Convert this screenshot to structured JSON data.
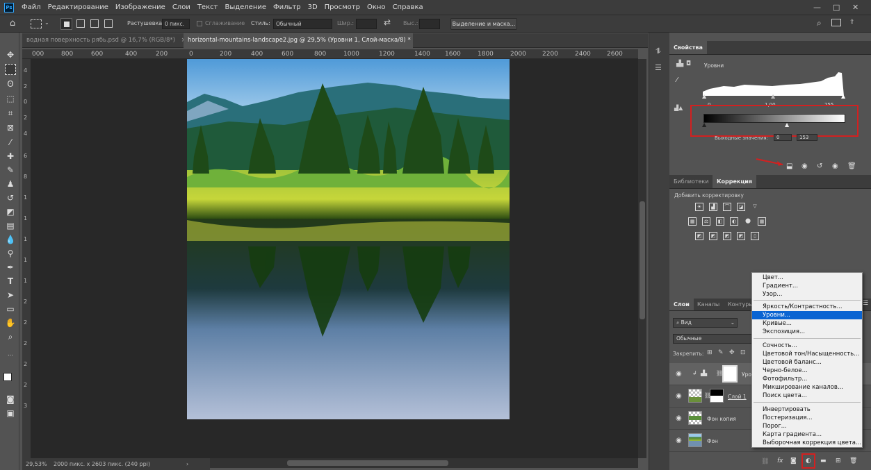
{
  "menubar": {
    "app_logo": "Ps",
    "items": [
      "Файл",
      "Редактирование",
      "Изображение",
      "Слои",
      "Текст",
      "Выделение",
      "Фильтр",
      "3D",
      "Просмотр",
      "Окно",
      "Справка"
    ],
    "window_controls": [
      "—",
      "□",
      "✕"
    ]
  },
  "options": {
    "feather_label": "Растушевка:",
    "feather_value": "0 пикс.",
    "antialias_label": "Сглаживание",
    "style_label": "Стиль:",
    "style_value": "Обычный",
    "width_label": "Шир.:",
    "height_label": "Выс.:",
    "select_mask_button": "Выделение и маска..."
  },
  "tabs": [
    {
      "label": "водная поверхность рябь.psd @ 16,7% (RGB/8*)",
      "close": "×"
    },
    {
      "label": "horizontal-mountains-landscape2.jpg @ 29,5% (Уровни 1, Слой-маска/8) *",
      "close": "×"
    }
  ],
  "ruler_top": [
    "000",
    "800",
    "600",
    "400",
    "200",
    "0",
    "200",
    "400",
    "600",
    "800",
    "1000",
    "1200",
    "1400",
    "1600",
    "1800",
    "2000",
    "2200",
    "2400",
    "2600"
  ],
  "ruler_left": [
    "4",
    "2",
    "0",
    "2",
    "4",
    "6",
    "8",
    "1",
    "1",
    "1",
    "1",
    "1",
    "2",
    "2",
    "2",
    "2",
    "2",
    "3"
  ],
  "status": {
    "zoom": "29,53%",
    "doc_info": "2000 пикс. x 2603 пикс. (240 ppi)"
  },
  "properties": {
    "tab": "Свойства",
    "type_label": "Уровни",
    "input_values": [
      "0",
      "1,00",
      "255"
    ],
    "output_label": "Выходные значения:",
    "output_values": [
      "0",
      "153"
    ]
  },
  "adjustments": {
    "tabs": [
      "Библиотеки",
      "Коррекция"
    ],
    "active_tab": "Коррекция",
    "add_label": "Добавить корректировку"
  },
  "layers": {
    "tabs": [
      "Слои",
      "Каналы",
      "Контуры"
    ],
    "active_tab": "Слои",
    "search_kind": "Вид",
    "blend_mode": "Обычные",
    "lock_label": "Закрепить:",
    "rows": [
      {
        "name": "Уро",
        "kind": "adjustment"
      },
      {
        "name": "Слой 1",
        "kind": "masked"
      },
      {
        "name": "Фон копия",
        "kind": "image"
      },
      {
        "name": "Фон",
        "kind": "image"
      }
    ]
  },
  "context_menu": {
    "groups": [
      [
        "Цвет...",
        "Градиент...",
        "Узор..."
      ],
      [
        "Яркость/Контрастность...",
        "Уровни...",
        "Кривые...",
        "Экспозиция..."
      ],
      [
        "Сочность...",
        "Цветовой тон/Насыщенность...",
        "Цветовой баланс...",
        "Черно-белое...",
        "Фотофильтр...",
        "Микширование каналов...",
        "Поиск цвета..."
      ],
      [
        "Инвертировать",
        "Постеризация...",
        "Порог...",
        "Карта градиента...",
        "Выборочная коррекция цвета..."
      ]
    ],
    "selected": "Уровни..."
  },
  "colors": {
    "highlight": "#d32020",
    "menu_selected": "#0a64d2",
    "panel_bg": "#535353",
    "canvas_bg": "#282828"
  }
}
